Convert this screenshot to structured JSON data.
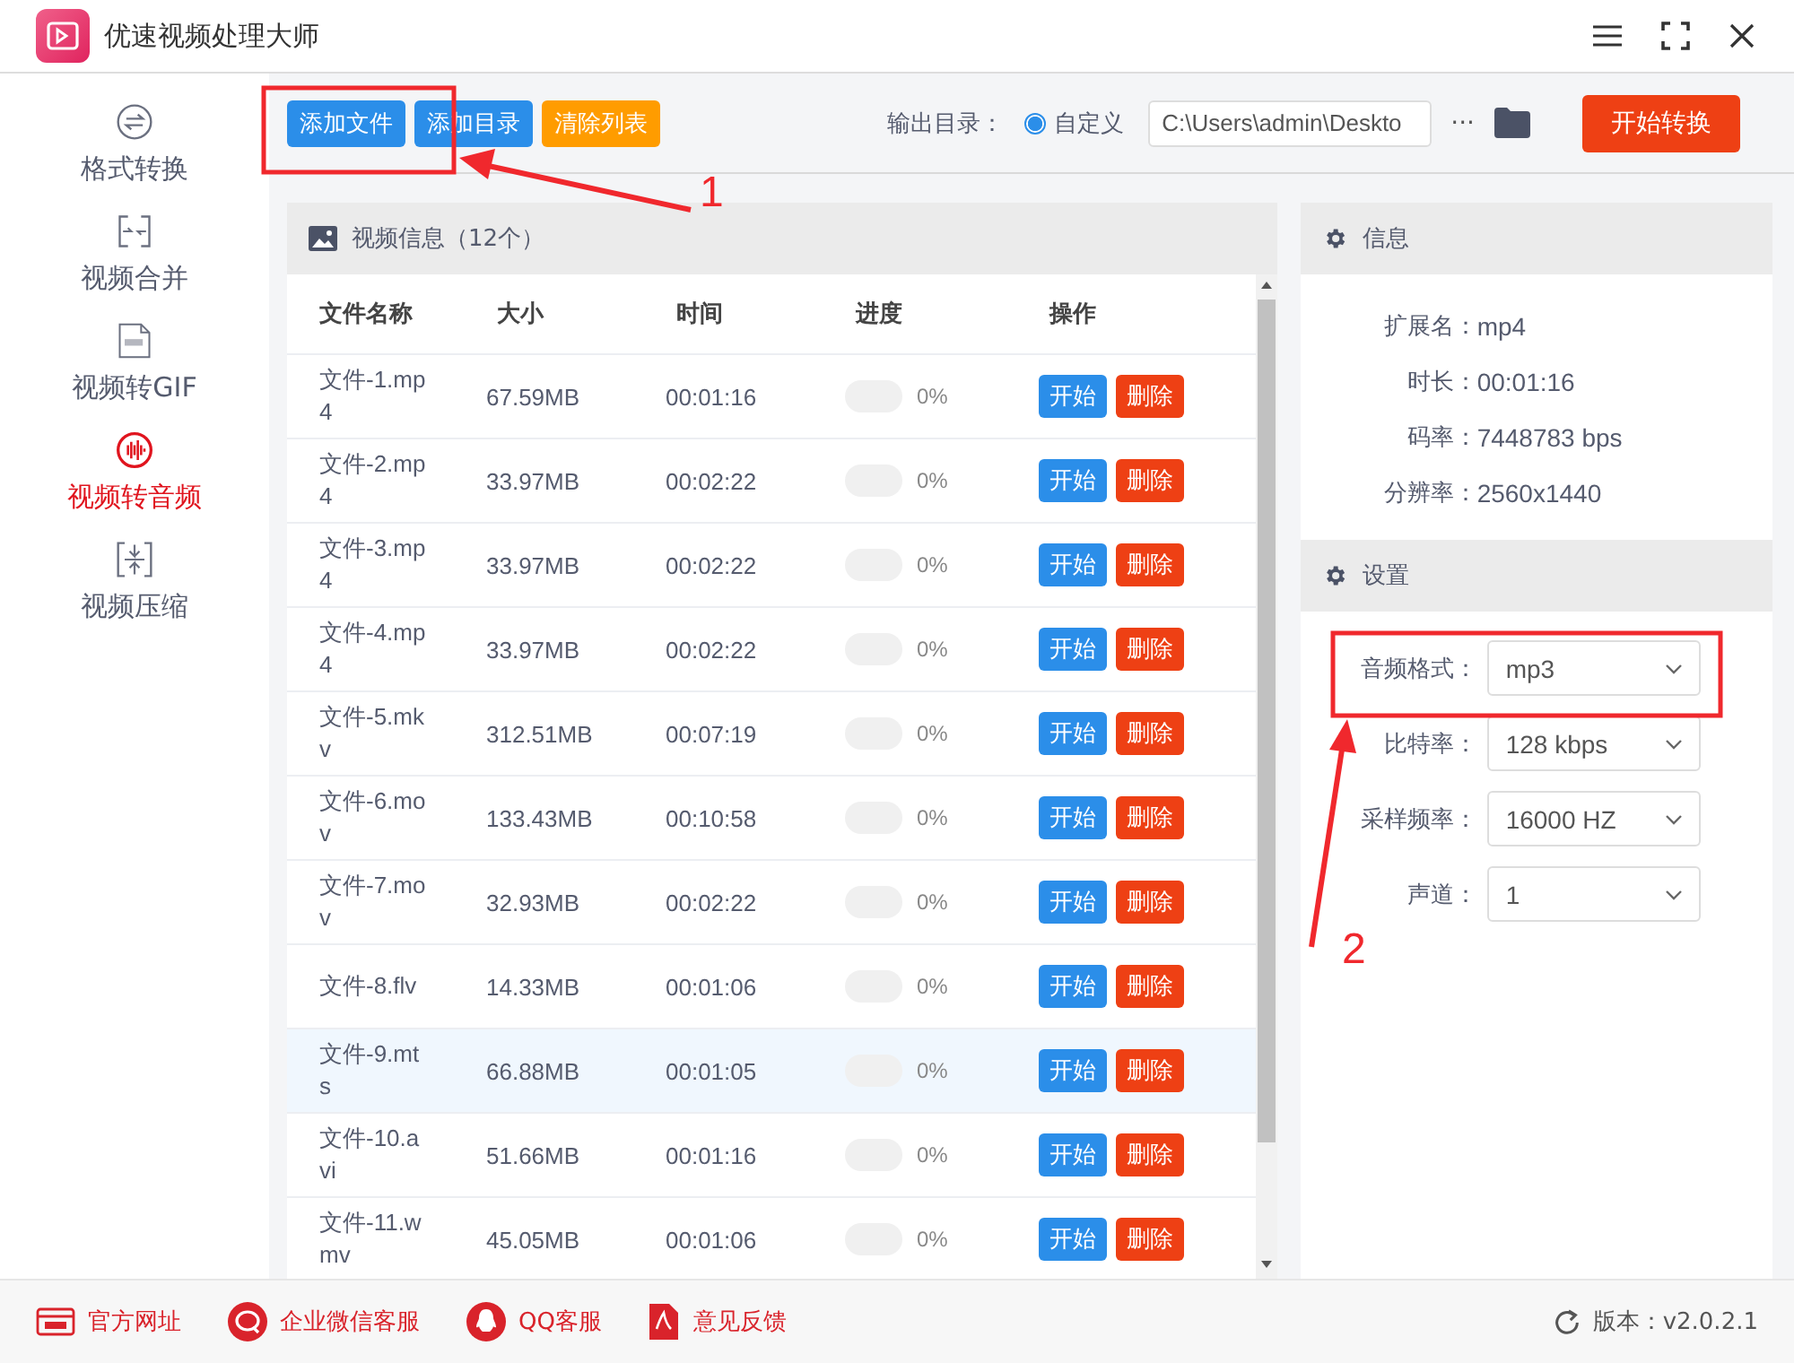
{
  "window": {
    "title": "优速视频处理大师"
  },
  "toolbar": {
    "buttons": [
      {
        "label": "添加文件",
        "kind": "primary"
      },
      {
        "label": "添加目录",
        "kind": "primary"
      },
      {
        "label": "清除列表",
        "kind": "warning"
      }
    ],
    "output_label": "输出目录：",
    "radio": {
      "label": "自定义",
      "selected": true
    },
    "path": "C:\\Users\\admin\\Deskto",
    "more": "···",
    "start_button": "开始转换"
  },
  "sidebar": {
    "items": [
      {
        "label": "格式转换",
        "kind": "convert",
        "selected": false
      },
      {
        "label": "视频合并",
        "kind": "merge",
        "selected": false
      },
      {
        "label": "视频转GIF",
        "kind": "gif",
        "selected": false
      },
      {
        "label": "视频转音频",
        "kind": "audio",
        "selected": true
      },
      {
        "label": "视频压缩",
        "kind": "compress",
        "selected": false
      }
    ]
  },
  "file_panel": {
    "title": "视频信息（12个）",
    "columns": [
      "文件名称",
      "大小",
      "时间",
      "进度",
      "操作"
    ],
    "rows": [
      {
        "name": "文件-1.mp4",
        "size": "67.59MB",
        "time": "00:01:16",
        "level": 0,
        "progress": "0%",
        "selected": false
      },
      {
        "name": "文件-2.mp4",
        "size": "33.97MB",
        "time": "00:02:22",
        "level": 0,
        "progress": "0%",
        "selected": false
      },
      {
        "name": "文件-3.mp4",
        "size": "33.97MB",
        "time": "00:02:22",
        "level": 0,
        "progress": "0%",
        "selected": false
      },
      {
        "name": "文件-4.mp4",
        "size": "33.97MB",
        "time": "00:02:22",
        "level": 0,
        "progress": "0%",
        "selected": false
      },
      {
        "name": "文件-5.mkv",
        "size": "312.51MB",
        "time": "00:07:19",
        "level": 0,
        "progress": "0%",
        "selected": false
      },
      {
        "name": "文件-6.mov",
        "size": "133.43MB",
        "time": "00:10:58",
        "level": 0,
        "progress": "0%",
        "selected": false
      },
      {
        "name": "文件-7.mov",
        "size": "32.93MB",
        "time": "00:02:22",
        "level": 0,
        "progress": "0%",
        "selected": false
      },
      {
        "name": "文件-8.flv",
        "size": "14.33MB",
        "time": "00:01:06",
        "level": 0,
        "progress": "0%",
        "selected": false
      },
      {
        "name": "文件-9.mts",
        "size": "66.88MB",
        "time": "00:01:05",
        "level": 0,
        "progress": "0%",
        "selected": true
      },
      {
        "name": "文件-10.avi",
        "size": "51.66MB",
        "time": "00:01:16",
        "level": 0,
        "progress": "0%",
        "selected": false
      },
      {
        "name": "文件-11.wmv",
        "size": "45.05MB",
        "time": "00:01:06",
        "level": 0,
        "progress": "0%",
        "selected": false
      }
    ],
    "row_actions": [
      "开始",
      "删除",
      "开始",
      "删除",
      "开始",
      "删除",
      "开始",
      "删除",
      "开始",
      "删除",
      "开始",
      "删除",
      "开始",
      "删除",
      "开始",
      "删除",
      "开始",
      "删除",
      "开始",
      "删除",
      "开始",
      "删除"
    ]
  },
  "info_panel": {
    "title": "信息",
    "fields": [
      {
        "label": "扩展名：",
        "value": "mp4"
      },
      {
        "label": "时长：",
        "value": "00:01:16"
      },
      {
        "label": "码率：",
        "value": "7448783 bps"
      },
      {
        "label": "分辨率：",
        "value": "2560x1440"
      }
    ]
  },
  "settings_panel": {
    "title": "设置",
    "fields": [
      {
        "label": "音频格式：",
        "value": "mp3"
      },
      {
        "label": "比特率：",
        "value": "128 kbps"
      },
      {
        "label": "采样频率：",
        "value": "16000 HZ"
      },
      {
        "label": "声道：",
        "value": "1"
      }
    ]
  },
  "footer": {
    "links": [
      {
        "label": "官方网址",
        "kind": "web"
      },
      {
        "label": "企业微信客服",
        "kind": "chat"
      },
      {
        "label": "QQ客服",
        "kind": "qq"
      },
      {
        "label": "意见反馈",
        "kind": "feedback"
      }
    ],
    "version": "版本：v2.0.2.1"
  },
  "annotations": [
    {
      "label": "1"
    },
    {
      "label": "2"
    }
  ]
}
